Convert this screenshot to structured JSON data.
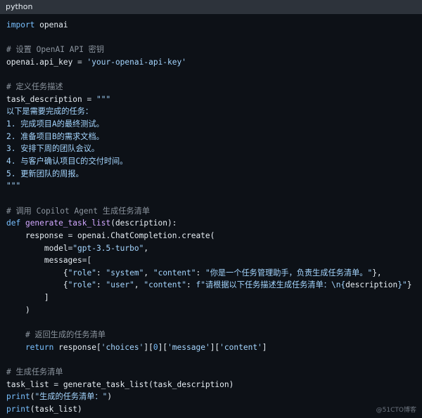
{
  "header": {
    "language": "python"
  },
  "code": {
    "lines": [
      [
        {
          "t": "import",
          "c": "kw"
        },
        {
          "t": " openai",
          "c": "plain"
        }
      ],
      [],
      [
        {
          "t": "# 设置 OpenAI API 密钥",
          "c": "cm"
        }
      ],
      [
        {
          "t": "openai",
          "c": "plain"
        },
        {
          "t": ".api_key ",
          "c": "plain"
        },
        {
          "t": "= ",
          "c": "op"
        },
        {
          "t": "'your-openai-api-key'",
          "c": "str"
        }
      ],
      [],
      [
        {
          "t": "# 定义任务描述",
          "c": "cm"
        }
      ],
      [
        {
          "t": "task_description ",
          "c": "plain"
        },
        {
          "t": "= ",
          "c": "op"
        },
        {
          "t": "\"\"\"",
          "c": "str"
        }
      ],
      [
        {
          "t": "以下是需要完成的任务：",
          "c": "docs"
        }
      ],
      [
        {
          "t": "1. 完成项目A的最终测试。",
          "c": "docs"
        }
      ],
      [
        {
          "t": "2. 准备项目B的需求文档。",
          "c": "docs"
        }
      ],
      [
        {
          "t": "3. 安排下周的团队会议。",
          "c": "docs"
        }
      ],
      [
        {
          "t": "4. 与客户确认项目C的交付时间。",
          "c": "docs"
        }
      ],
      [
        {
          "t": "5. 更新团队的周报。",
          "c": "docs"
        }
      ],
      [
        {
          "t": "\"\"\"",
          "c": "str"
        }
      ],
      [],
      [
        {
          "t": "# 调用 Copilot Agent 生成任务清单",
          "c": "cm"
        }
      ],
      [
        {
          "t": "def ",
          "c": "kw"
        },
        {
          "t": "generate_task_list",
          "c": "fn"
        },
        {
          "t": "(description):",
          "c": "plain"
        }
      ],
      [
        {
          "t": "    response ",
          "c": "plain"
        },
        {
          "t": "= ",
          "c": "op"
        },
        {
          "t": "openai",
          "c": "plain"
        },
        {
          "t": ".ChatCompletion.create(",
          "c": "plain"
        }
      ],
      [
        {
          "t": "        model",
          "c": "plain"
        },
        {
          "t": "=",
          "c": "op"
        },
        {
          "t": "\"gpt-3.5-turbo\"",
          "c": "str"
        },
        {
          "t": ",",
          "c": "plain"
        }
      ],
      [
        {
          "t": "        messages",
          "c": "plain"
        },
        {
          "t": "=[",
          "c": "op"
        }
      ],
      [
        {
          "t": "            {",
          "c": "plain"
        },
        {
          "t": "\"role\"",
          "c": "str"
        },
        {
          "t": ": ",
          "c": "plain"
        },
        {
          "t": "\"system\"",
          "c": "str"
        },
        {
          "t": ", ",
          "c": "plain"
        },
        {
          "t": "\"content\"",
          "c": "str"
        },
        {
          "t": ": ",
          "c": "plain"
        },
        {
          "t": "\"你是一个任务管理助手，负责生成任务清单。\"",
          "c": "str"
        },
        {
          "t": "},",
          "c": "plain"
        }
      ],
      [
        {
          "t": "            {",
          "c": "plain"
        },
        {
          "t": "\"role\"",
          "c": "str"
        },
        {
          "t": ": ",
          "c": "plain"
        },
        {
          "t": "\"user\"",
          "c": "str"
        },
        {
          "t": ", ",
          "c": "plain"
        },
        {
          "t": "\"content\"",
          "c": "str"
        },
        {
          "t": ": ",
          "c": "plain"
        },
        {
          "t": "f\"请根据以下任务描述生成任务清单：\\n{",
          "c": "str"
        },
        {
          "t": "description",
          "c": "plain"
        },
        {
          "t": "}\"",
          "c": "str"
        },
        {
          "t": "}",
          "c": "plain"
        }
      ],
      [
        {
          "t": "        ]",
          "c": "plain"
        }
      ],
      [
        {
          "t": "    )",
          "c": "plain"
        }
      ],
      [],
      [
        {
          "t": "    # 返回生成的任务清单",
          "c": "cm"
        }
      ],
      [
        {
          "t": "    return ",
          "c": "kw"
        },
        {
          "t": "response[",
          "c": "plain"
        },
        {
          "t": "'choices'",
          "c": "str"
        },
        {
          "t": "][",
          "c": "plain"
        },
        {
          "t": "0",
          "c": "bi"
        },
        {
          "t": "][",
          "c": "plain"
        },
        {
          "t": "'message'",
          "c": "str"
        },
        {
          "t": "][",
          "c": "plain"
        },
        {
          "t": "'content'",
          "c": "str"
        },
        {
          "t": "]",
          "c": "plain"
        }
      ],
      [],
      [
        {
          "t": "# 生成任务清单",
          "c": "cm"
        }
      ],
      [
        {
          "t": "task_list ",
          "c": "plain"
        },
        {
          "t": "= ",
          "c": "op"
        },
        {
          "t": "generate_task_list(task_description)",
          "c": "plain"
        }
      ],
      [
        {
          "t": "print",
          "c": "bi"
        },
        {
          "t": "(",
          "c": "plain"
        },
        {
          "t": "\"生成的任务清单：\"",
          "c": "str"
        },
        {
          "t": ")",
          "c": "plain"
        }
      ],
      [
        {
          "t": "print",
          "c": "bi"
        },
        {
          "t": "(task_list)",
          "c": "plain"
        }
      ]
    ]
  },
  "watermark": {
    "text": "@51CTO博客"
  }
}
